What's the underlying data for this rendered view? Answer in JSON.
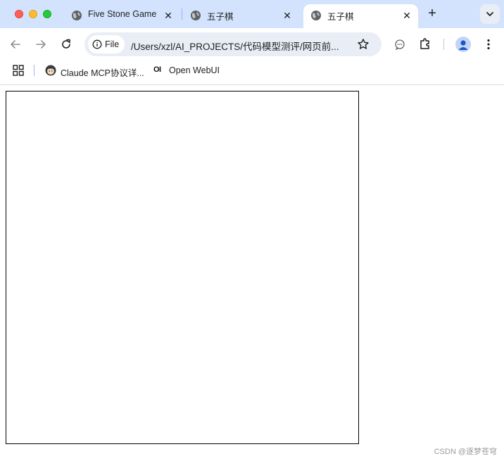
{
  "tabs": [
    {
      "title": "Five Stone Game",
      "active": false
    },
    {
      "title": "五子棋",
      "active": false
    },
    {
      "title": "五子棋",
      "active": true
    }
  ],
  "toolbar": {
    "chip_label": "File",
    "url": "/Users/xzl/AI_PROJECTS/代码模型测评/网页前..."
  },
  "bookmarks": [
    {
      "label": "Claude MCP协议详..."
    },
    {
      "label": "Open WebUI",
      "icon_text": "OI"
    }
  ],
  "watermark": "CSDN @逐梦苍穹",
  "colors": {
    "tabstrip": "#d3e3fd",
    "omnibox": "#e9eef6",
    "board_border": "#000000"
  }
}
